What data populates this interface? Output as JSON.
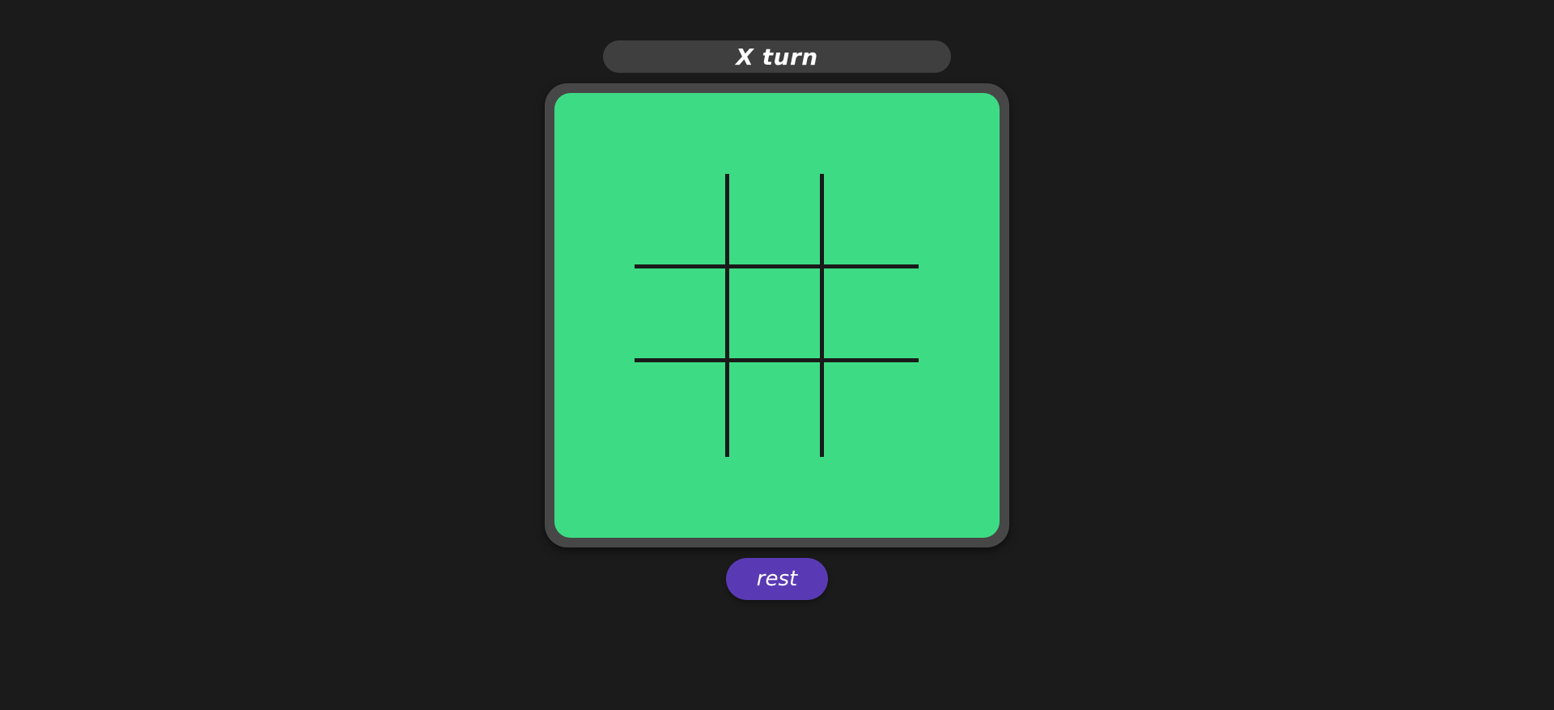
{
  "status": {
    "text": "X turn"
  },
  "board": {
    "cells": [
      "",
      "",
      "",
      "",
      "",
      "",
      "",
      "",
      ""
    ]
  },
  "controls": {
    "reset_label": "rest"
  },
  "colors": {
    "background": "#1b1b1b",
    "board": "#3ddc84",
    "board_frame": "#474747",
    "grid_lines": "#1a1a1a",
    "status_bar": "#3f3f3f",
    "reset_button": "#5a3ab4",
    "text": "#ffffff"
  }
}
